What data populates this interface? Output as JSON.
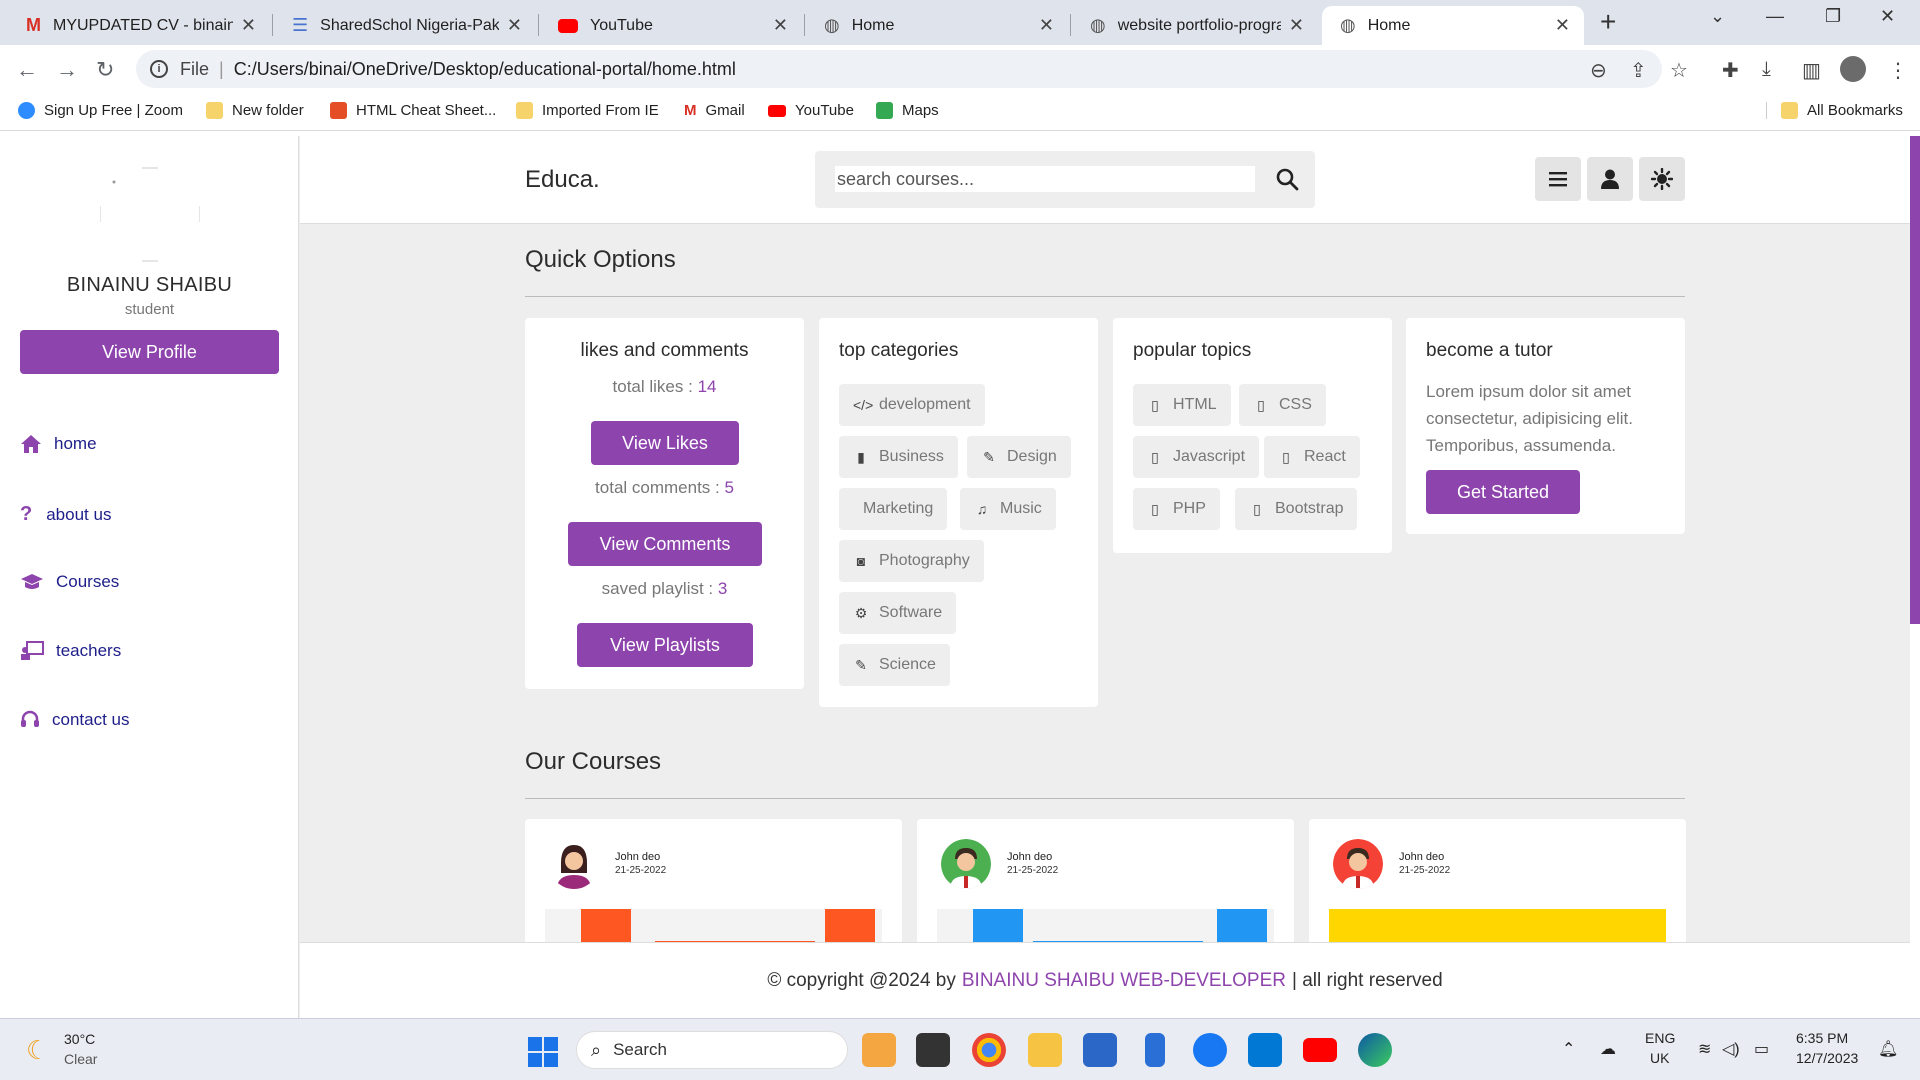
{
  "browser": {
    "tabs": [
      {
        "title": "MYUPDATED CV - binainus",
        "active": false
      },
      {
        "title": "SharedSchol Nigeria-Pakist",
        "active": false
      },
      {
        "title": "YouTube",
        "active": false
      },
      {
        "title": "Home",
        "active": false
      },
      {
        "title": "website portfolio-program",
        "active": false
      },
      {
        "title": "Home",
        "active": true
      }
    ],
    "address": {
      "scheme": "File",
      "url": "C:/Users/binai/OneDrive/Desktop/educational-portal/home.html"
    },
    "bookmarks": [
      "Sign Up Free | Zoom",
      "New folder",
      "HTML Cheat Sheet...",
      "Imported From IE",
      "Gmail",
      "YouTube",
      "Maps"
    ],
    "all_bookmarks": "All Bookmarks"
  },
  "sidebar": {
    "name": "BINAINU SHAIBU",
    "role": "student",
    "view_profile": "View Profile",
    "items": [
      {
        "label": "home",
        "icon": "home-icon"
      },
      {
        "label": "about us",
        "icon": "question-icon"
      },
      {
        "label": "Courses",
        "icon": "graduation-cap-icon"
      },
      {
        "label": "teachers",
        "icon": "teacher-icon"
      },
      {
        "label": "contact us",
        "icon": "headset-icon"
      }
    ]
  },
  "header": {
    "logo": "Educa.",
    "search_placeholder": "search  courses..."
  },
  "quick_options": {
    "title": "Quick Options",
    "likes_card": {
      "title": "likes and comments",
      "likes_label": "total likes : ",
      "likes_value": "14",
      "view_likes": "View Likes",
      "comments_label": "total comments : ",
      "comments_value": "5",
      "view_comments": "View Comments",
      "playlist_label": "saved playlist : ",
      "playlist_value": "3",
      "view_playlists": "View Playlists"
    },
    "categories_card": {
      "title": "top categories",
      "chips": [
        "development",
        "Business",
        "Design",
        "Marketing",
        "Music",
        "Photography",
        "Software",
        "Science"
      ]
    },
    "topics_card": {
      "title": "popular topics",
      "chips": [
        "HTML",
        "CSS",
        "Javascript",
        "React",
        "PHP",
        "Bootstrap"
      ]
    },
    "tutor_card": {
      "title": "become a tutor",
      "text": "Lorem ipsum dolor sit amet consectetur, adipisicing elit. Temporibus, assumenda.",
      "button": "Get Started"
    }
  },
  "courses": {
    "title": "Our Courses",
    "items": [
      {
        "author": "John deo",
        "date": "21-25-2022",
        "accent": "#ff5722"
      },
      {
        "author": "John deo",
        "date": "21-25-2022",
        "accent": "#2196f3"
      },
      {
        "author": "John deo",
        "date": "21-25-2022",
        "accent": "#ffd600"
      }
    ]
  },
  "footer": {
    "prefix": "© copyright @2024 by",
    "highlight": "BINAINU SHAIBU WEB-DEVELOPER",
    "suffix": "| all right reserved"
  },
  "taskbar": {
    "weather_temp": "30°C",
    "weather_desc": "Clear",
    "search": "Search",
    "lang": "ENG",
    "region": "UK",
    "time": "6:35 PM",
    "date": "12/7/2023"
  },
  "colors": {
    "accent": "#8e44ad",
    "page_bg": "#eeeeee"
  }
}
